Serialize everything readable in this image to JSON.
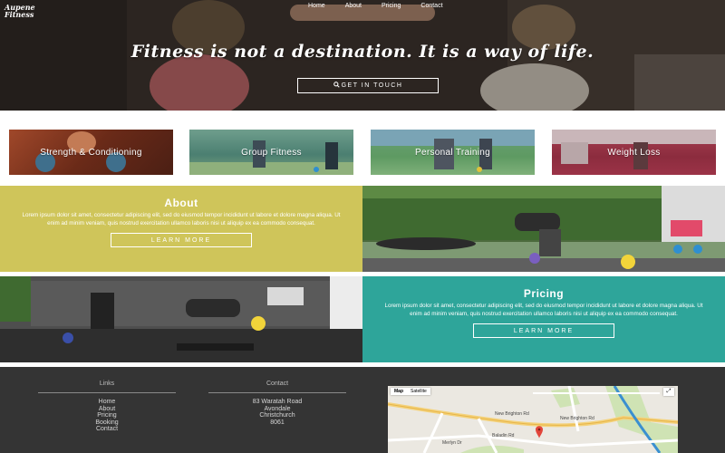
{
  "brand": {
    "logo_text": "Aupene Fitness"
  },
  "nav": {
    "items": [
      "Home",
      "About",
      "Pricing",
      "Contact"
    ]
  },
  "hero": {
    "tagline": "Fitness is not a destination. It is a way of life.",
    "cta_label": "GET IN TOUCH",
    "cta_icon": "search-icon"
  },
  "categories": [
    {
      "label": "Strength & Conditioning",
      "color": "#8a3a22"
    },
    {
      "label": "Group Fitness",
      "color": "#5d8c7c"
    },
    {
      "label": "Personal Training",
      "color": "#5e9a62"
    },
    {
      "label": "Weight Loss",
      "color": "#9b3347"
    }
  ],
  "about": {
    "title": "About",
    "text": "Lorem ipsum dolor sit amet, consectetur adipiscing elit, sed do eiusmod tempor incididunt ut labore et dolore magna aliqua. Ut enim ad minim veniam, quis nostrud exercitation ullamco laboris nisi ut aliquip ex ea commodo consequat.",
    "button_label": "LEARN MORE",
    "color": "#cfc55a"
  },
  "pricing": {
    "title": "Pricing",
    "text": "Lorem ipsum dolor sit amet, consectetur adipiscing elit, sed do eiusmod tempor incididunt ut labore et dolore magna aliqua. Ut enim ad minim veniam, quis nostrud exercitation ullamco laboris nisi ut aliquip ex ea commodo consequat.",
    "button_label": "LEARN MORE",
    "color": "#2ea59a"
  },
  "footer": {
    "links_heading": "Links",
    "links": [
      "Home",
      "About",
      "Pricing",
      "Booking",
      "Contact"
    ],
    "contact_heading": "Contact",
    "address": [
      "83 Waratah Road",
      "Avondale",
      "Christchurch",
      "8061"
    ]
  },
  "map": {
    "tabs": [
      "Map",
      "Satellite"
    ],
    "road_labels": [
      "New Brighton Rd",
      "New Brighton Rd",
      "Merlyn Dr",
      "Baladin Rd"
    ]
  }
}
